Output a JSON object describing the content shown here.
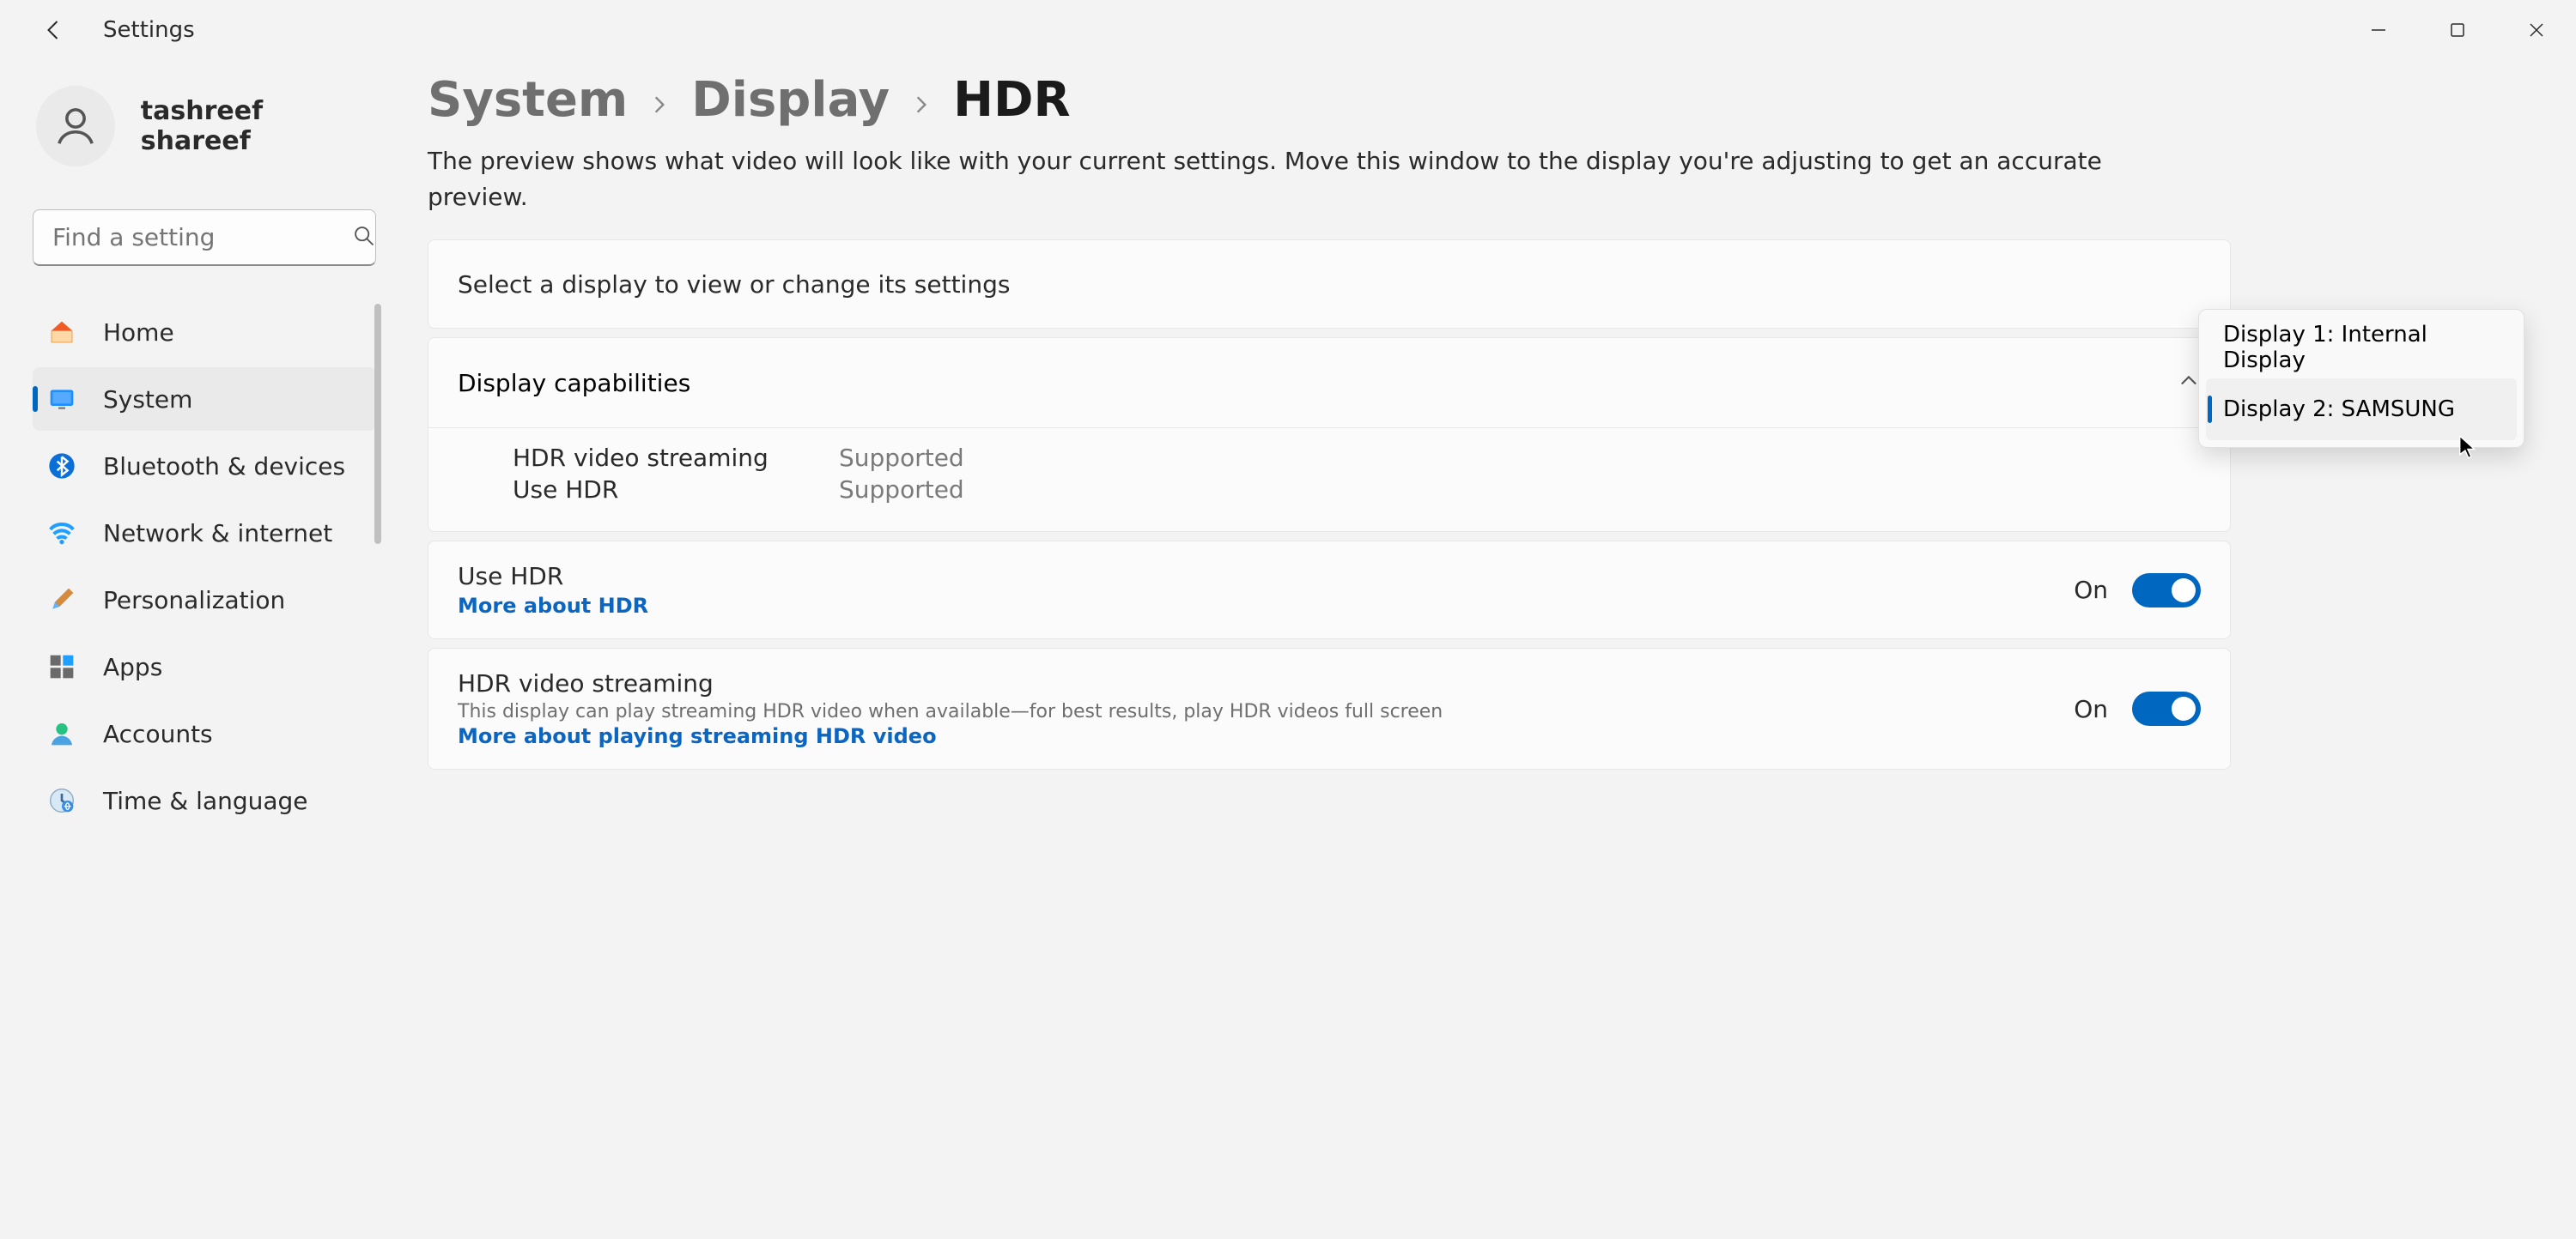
{
  "titlebar": {
    "app_title": "Settings"
  },
  "user": {
    "name": "tashreef shareef"
  },
  "search": {
    "placeholder": "Find a setting"
  },
  "nav": {
    "items": [
      {
        "label": "Home"
      },
      {
        "label": "System"
      },
      {
        "label": "Bluetooth & devices"
      },
      {
        "label": "Network & internet"
      },
      {
        "label": "Personalization"
      },
      {
        "label": "Apps"
      },
      {
        "label": "Accounts"
      },
      {
        "label": "Time & language"
      }
    ]
  },
  "breadcrumb": {
    "system": "System",
    "display": "Display",
    "current": "HDR"
  },
  "description": "The preview shows what video will look like with your current settings. Move this window to the display you're adjusting to get an accurate preview.",
  "select_display": {
    "label": "Select a display to view or change its settings"
  },
  "dropdown": {
    "item1": "Display 1: Internal Display",
    "item2": "Display 2: SAMSUNG"
  },
  "capabilities": {
    "title": "Display capabilities",
    "rows": [
      {
        "name": "HDR video streaming",
        "value": "Supported"
      },
      {
        "name": "Use HDR",
        "value": "Supported"
      }
    ]
  },
  "use_hdr": {
    "title": "Use HDR",
    "link": "More about HDR",
    "state": "On"
  },
  "hdr_streaming": {
    "title": "HDR video streaming",
    "desc": "This display can play streaming HDR video when available—for best results, play HDR videos full screen",
    "link": "More about playing streaming HDR video",
    "state": "On"
  }
}
